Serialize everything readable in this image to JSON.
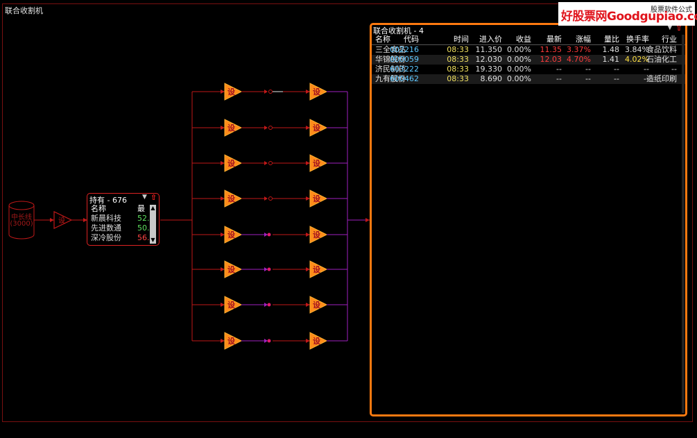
{
  "window": {
    "title": "联合收割机"
  },
  "watermark": {
    "main": "好股票网Goodgupiao.com",
    "sub": "股票软件公式"
  },
  "source": {
    "line1": "中长线",
    "line2": "(3000)"
  },
  "holding": {
    "title": "持有 - 676",
    "headers": {
      "name": "名称",
      "latest": "最"
    },
    "rows": [
      {
        "name": "新晨科技",
        "value": "52.",
        "color": "#5fe05f"
      },
      {
        "name": "先进数通",
        "value": "50.",
        "color": "#5fe05f"
      },
      {
        "name": "深冷股份",
        "value": "56.",
        "color": "#ff4545"
      }
    ]
  },
  "results": {
    "title": "联合收割机 - 4",
    "columns": [
      "名称",
      "代码",
      "时间",
      "进入价",
      "收益",
      "最新",
      "涨幅",
      "量比",
      "换手率",
      "行业"
    ],
    "rows": [
      {
        "name": "三全食品",
        "code": "002216",
        "time": "08:33",
        "price": "11.350",
        "gain": "0.00%",
        "last": "11.35",
        "chg": "3.37%",
        "vol": "1.48",
        "turn": "3.84%",
        "ind": "食品饮料",
        "lastc": "up",
        "turnc": "flat"
      },
      {
        "name": "华锦股份",
        "code": "000059",
        "time": "08:33",
        "price": "12.030",
        "gain": "0.00%",
        "last": "12.03",
        "chg": "4.70%",
        "vol": "1.41",
        "turn": "4.02%",
        "ind": "石油化工",
        "lastc": "up",
        "turnc": "yel"
      },
      {
        "name": "济民制药",
        "code": "603222",
        "time": "08:33",
        "price": "19.330",
        "gain": "0.00%",
        "last": "--",
        "chg": "--",
        "vol": "--",
        "turn": "--",
        "ind": "--",
        "lastc": "flat",
        "turnc": "flat"
      },
      {
        "name": "九有股份",
        "code": "600462",
        "time": "08:33",
        "price": "8.690",
        "gain": "0.00%",
        "last": "--",
        "chg": "--",
        "vol": "--",
        "turn": "--",
        "ind": "造纸印刷",
        "lastc": "flat",
        "turnc": "flat"
      }
    ]
  },
  "flow": {
    "node_label": "设",
    "branch_count": 8
  }
}
